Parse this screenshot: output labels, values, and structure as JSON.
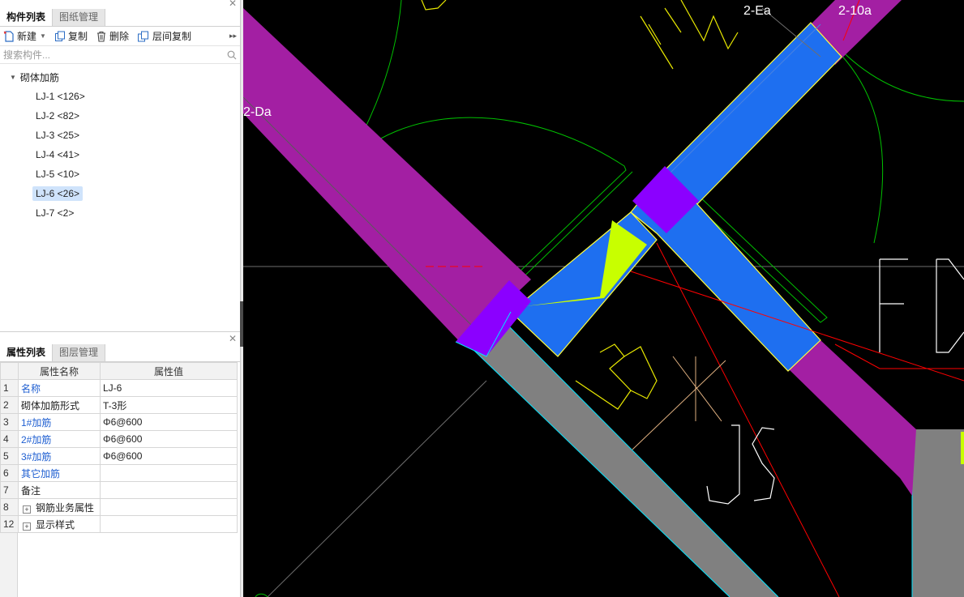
{
  "component_panel": {
    "tabs": [
      {
        "label": "构件列表",
        "active": true
      },
      {
        "label": "图纸管理",
        "active": false
      }
    ],
    "toolbar": {
      "new_label": "新建",
      "copy_label": "复制",
      "delete_label": "删除",
      "floor_copy_label": "层间复制"
    },
    "search": {
      "placeholder": "搜索构件..."
    },
    "tree": {
      "root_label": "砌体加筋",
      "items": [
        {
          "label": "LJ-1 <126>"
        },
        {
          "label": "LJ-2 <82>"
        },
        {
          "label": "LJ-3 <25>"
        },
        {
          "label": "LJ-4 <41>"
        },
        {
          "label": "LJ-5 <10>"
        },
        {
          "label": "LJ-6 <26>",
          "selected": true
        },
        {
          "label": "LJ-7 <2>"
        }
      ]
    }
  },
  "property_panel": {
    "tabs": [
      {
        "label": "属性列表",
        "active": true
      },
      {
        "label": "图层管理",
        "active": false
      }
    ],
    "columns": [
      "属性名称",
      "属性值"
    ],
    "rows": [
      {
        "num": "1",
        "name": "名称",
        "value": "LJ-6"
      },
      {
        "num": "2",
        "name": "砌体加筋形式",
        "value": "T-3形"
      },
      {
        "num": "3",
        "name": "1#加筋",
        "value": "Φ6@600"
      },
      {
        "num": "4",
        "name": "2#加筋",
        "value": "Φ6@600"
      },
      {
        "num": "5",
        "name": "3#加筋",
        "value": "Φ6@600"
      },
      {
        "num": "6",
        "name": "其它加筋",
        "value": ""
      },
      {
        "num": "7",
        "name": "备注",
        "value": ""
      },
      {
        "num": "8",
        "name": "钢筋业务属性",
        "value": ""
      },
      {
        "num": "12",
        "name": "显示样式",
        "value": ""
      }
    ]
  },
  "canvas": {
    "labels": {
      "axis_2_ea": "2-Ea",
      "axis_2_10a": "2-10a",
      "axis_2_da": "2-Da"
    },
    "colors": {
      "background": "#000000",
      "wall_purple": "#a020a0",
      "wall_blue": "#1e6ff0",
      "wall_violet": "#8b00ff",
      "wall_gray": "#808080",
      "rebar_yellowgreen": "#c8ff00",
      "outline_cyan": "#00e5ff",
      "arc_green": "#00c000",
      "line_red": "#ff0000",
      "text_yellow": "#e8e800",
      "text_white": "#ffffff"
    }
  }
}
